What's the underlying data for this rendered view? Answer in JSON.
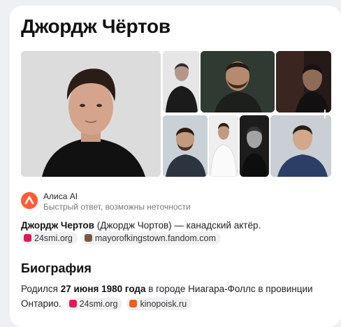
{
  "entity": {
    "title": "Джордж Чёртов"
  },
  "gallery": {
    "images": [
      {
        "name": "main-portrait"
      },
      {
        "name": "thumb-black-jacket"
      },
      {
        "name": "thumb-bearded"
      },
      {
        "name": "thumb-dark-portrait"
      },
      {
        "name": "thumb-suit"
      },
      {
        "name": "thumb-white-shirt"
      },
      {
        "name": "thumb-black-white"
      },
      {
        "name": "thumb-blue-suit"
      }
    ],
    "more_icon": "plus-icon"
  },
  "alice": {
    "name": "Алиса AI",
    "note": "Быстрый ответ, возможны неточности",
    "logo_color": "#ff5c35"
  },
  "answer": {
    "bold_name": "Джордж Чертов",
    "rest": " (Джордж Чортов) — канадский актёр.",
    "sources": [
      {
        "label": "24smi.org",
        "color": "#e0195a"
      },
      {
        "label": "mayorofkingstown.fandom.com",
        "color": "#7a5a3a"
      }
    ]
  },
  "biography": {
    "heading": "Биография",
    "part1": "Родился ",
    "bold_date": "27 июня 1980 года",
    "part2": " в городе Ниагара-Фоллс в провинции",
    "line2": "Онтарио.",
    "sources": [
      {
        "label": "24smi.org",
        "color": "#e0195a"
      },
      {
        "label": "kinopoisk.ru",
        "color": "#f25e18"
      }
    ]
  }
}
